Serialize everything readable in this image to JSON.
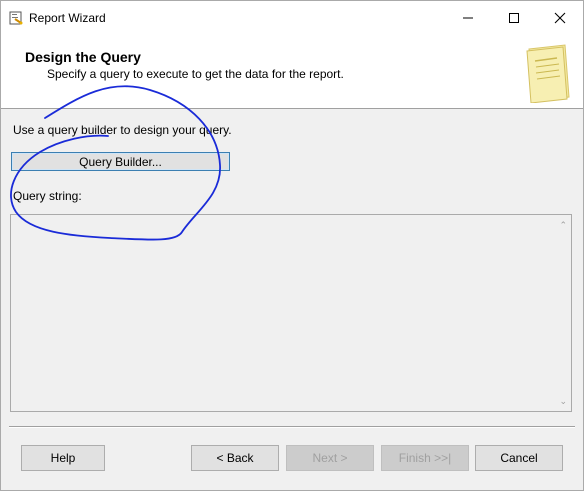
{
  "window": {
    "title": "Report Wizard",
    "minimize": "minimize-icon",
    "maximize": "maximize-icon",
    "close": "close-icon"
  },
  "header": {
    "title": "Design the Query",
    "subtitle": "Specify a query to execute to get the data for the report."
  },
  "body": {
    "instructions": "Use a query builder to design your query.",
    "query_builder_label": "Query Builder...",
    "query_string_label": "Query string:",
    "query_string_value": ""
  },
  "footer": {
    "help": "Help",
    "back": "< Back",
    "next": "Next >",
    "finish": "Finish >>|",
    "cancel": "Cancel"
  },
  "colors": {
    "accent": "#0078d7",
    "scribble": "#1a2bd8",
    "window_bg": "#f0f0f0"
  }
}
